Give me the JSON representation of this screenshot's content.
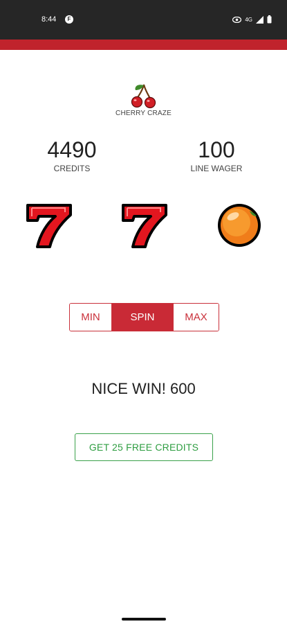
{
  "status_bar": {
    "time": "8:44",
    "app_icon_letter": "F",
    "network_type": "4G",
    "icons": [
      "app-notification-icon",
      "eye-icon",
      "signal-icon",
      "battery-icon"
    ]
  },
  "app": {
    "name": "CHERRY CRAZE",
    "logo_icon": "cherry-icon",
    "accent_color": "#c0232c"
  },
  "stats": {
    "credits": {
      "value": "4490",
      "label": "CREDITS"
    },
    "wager": {
      "value": "100",
      "label": "LINE WAGER"
    }
  },
  "reels": [
    {
      "symbol": "seven-icon"
    },
    {
      "symbol": "seven-icon"
    },
    {
      "symbol": "orange-icon"
    }
  ],
  "controls": {
    "min_label": "MIN",
    "spin_label": "SPIN",
    "max_label": "MAX"
  },
  "result": {
    "message": "NICE WIN! 600"
  },
  "free_credits": {
    "label": "GET 25 FREE CREDITS",
    "color": "#2e9d41"
  }
}
